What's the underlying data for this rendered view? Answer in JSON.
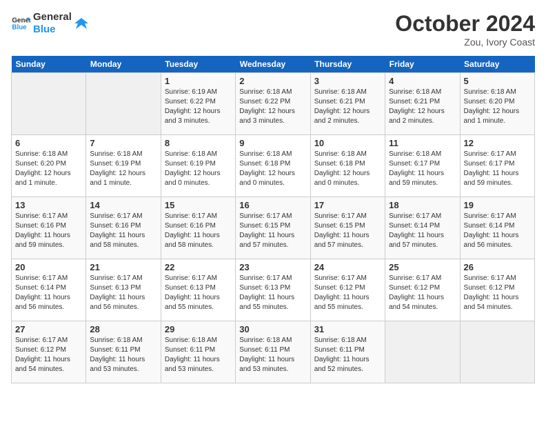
{
  "header": {
    "logo_general": "General",
    "logo_blue": "Blue",
    "month": "October 2024",
    "location": "Zou, Ivory Coast"
  },
  "weekdays": [
    "Sunday",
    "Monday",
    "Tuesday",
    "Wednesday",
    "Thursday",
    "Friday",
    "Saturday"
  ],
  "weeks": [
    [
      {
        "day": "",
        "info": ""
      },
      {
        "day": "",
        "info": ""
      },
      {
        "day": "1",
        "info": "Sunrise: 6:19 AM\nSunset: 6:22 PM\nDaylight: 12 hours and 3 minutes."
      },
      {
        "day": "2",
        "info": "Sunrise: 6:18 AM\nSunset: 6:22 PM\nDaylight: 12 hours and 3 minutes."
      },
      {
        "day": "3",
        "info": "Sunrise: 6:18 AM\nSunset: 6:21 PM\nDaylight: 12 hours and 2 minutes."
      },
      {
        "day": "4",
        "info": "Sunrise: 6:18 AM\nSunset: 6:21 PM\nDaylight: 12 hours and 2 minutes."
      },
      {
        "day": "5",
        "info": "Sunrise: 6:18 AM\nSunset: 6:20 PM\nDaylight: 12 hours and 1 minute."
      }
    ],
    [
      {
        "day": "6",
        "info": "Sunrise: 6:18 AM\nSunset: 6:20 PM\nDaylight: 12 hours and 1 minute."
      },
      {
        "day": "7",
        "info": "Sunrise: 6:18 AM\nSunset: 6:19 PM\nDaylight: 12 hours and 1 minute."
      },
      {
        "day": "8",
        "info": "Sunrise: 6:18 AM\nSunset: 6:19 PM\nDaylight: 12 hours and 0 minutes."
      },
      {
        "day": "9",
        "info": "Sunrise: 6:18 AM\nSunset: 6:18 PM\nDaylight: 12 hours and 0 minutes."
      },
      {
        "day": "10",
        "info": "Sunrise: 6:18 AM\nSunset: 6:18 PM\nDaylight: 12 hours and 0 minutes."
      },
      {
        "day": "11",
        "info": "Sunrise: 6:18 AM\nSunset: 6:17 PM\nDaylight: 11 hours and 59 minutes."
      },
      {
        "day": "12",
        "info": "Sunrise: 6:17 AM\nSunset: 6:17 PM\nDaylight: 11 hours and 59 minutes."
      }
    ],
    [
      {
        "day": "13",
        "info": "Sunrise: 6:17 AM\nSunset: 6:16 PM\nDaylight: 11 hours and 59 minutes."
      },
      {
        "day": "14",
        "info": "Sunrise: 6:17 AM\nSunset: 6:16 PM\nDaylight: 11 hours and 58 minutes."
      },
      {
        "day": "15",
        "info": "Sunrise: 6:17 AM\nSunset: 6:16 PM\nDaylight: 11 hours and 58 minutes."
      },
      {
        "day": "16",
        "info": "Sunrise: 6:17 AM\nSunset: 6:15 PM\nDaylight: 11 hours and 57 minutes."
      },
      {
        "day": "17",
        "info": "Sunrise: 6:17 AM\nSunset: 6:15 PM\nDaylight: 11 hours and 57 minutes."
      },
      {
        "day": "18",
        "info": "Sunrise: 6:17 AM\nSunset: 6:14 PM\nDaylight: 11 hours and 57 minutes."
      },
      {
        "day": "19",
        "info": "Sunrise: 6:17 AM\nSunset: 6:14 PM\nDaylight: 11 hours and 56 minutes."
      }
    ],
    [
      {
        "day": "20",
        "info": "Sunrise: 6:17 AM\nSunset: 6:14 PM\nDaylight: 11 hours and 56 minutes."
      },
      {
        "day": "21",
        "info": "Sunrise: 6:17 AM\nSunset: 6:13 PM\nDaylight: 11 hours and 56 minutes."
      },
      {
        "day": "22",
        "info": "Sunrise: 6:17 AM\nSunset: 6:13 PM\nDaylight: 11 hours and 55 minutes."
      },
      {
        "day": "23",
        "info": "Sunrise: 6:17 AM\nSunset: 6:13 PM\nDaylight: 11 hours and 55 minutes."
      },
      {
        "day": "24",
        "info": "Sunrise: 6:17 AM\nSunset: 6:12 PM\nDaylight: 11 hours and 55 minutes."
      },
      {
        "day": "25",
        "info": "Sunrise: 6:17 AM\nSunset: 6:12 PM\nDaylight: 11 hours and 54 minutes."
      },
      {
        "day": "26",
        "info": "Sunrise: 6:17 AM\nSunset: 6:12 PM\nDaylight: 11 hours and 54 minutes."
      }
    ],
    [
      {
        "day": "27",
        "info": "Sunrise: 6:17 AM\nSunset: 6:12 PM\nDaylight: 11 hours and 54 minutes."
      },
      {
        "day": "28",
        "info": "Sunrise: 6:18 AM\nSunset: 6:11 PM\nDaylight: 11 hours and 53 minutes."
      },
      {
        "day": "29",
        "info": "Sunrise: 6:18 AM\nSunset: 6:11 PM\nDaylight: 11 hours and 53 minutes."
      },
      {
        "day": "30",
        "info": "Sunrise: 6:18 AM\nSunset: 6:11 PM\nDaylight: 11 hours and 53 minutes."
      },
      {
        "day": "31",
        "info": "Sunrise: 6:18 AM\nSunset: 6:11 PM\nDaylight: 11 hours and 52 minutes."
      },
      {
        "day": "",
        "info": ""
      },
      {
        "day": "",
        "info": ""
      }
    ]
  ]
}
